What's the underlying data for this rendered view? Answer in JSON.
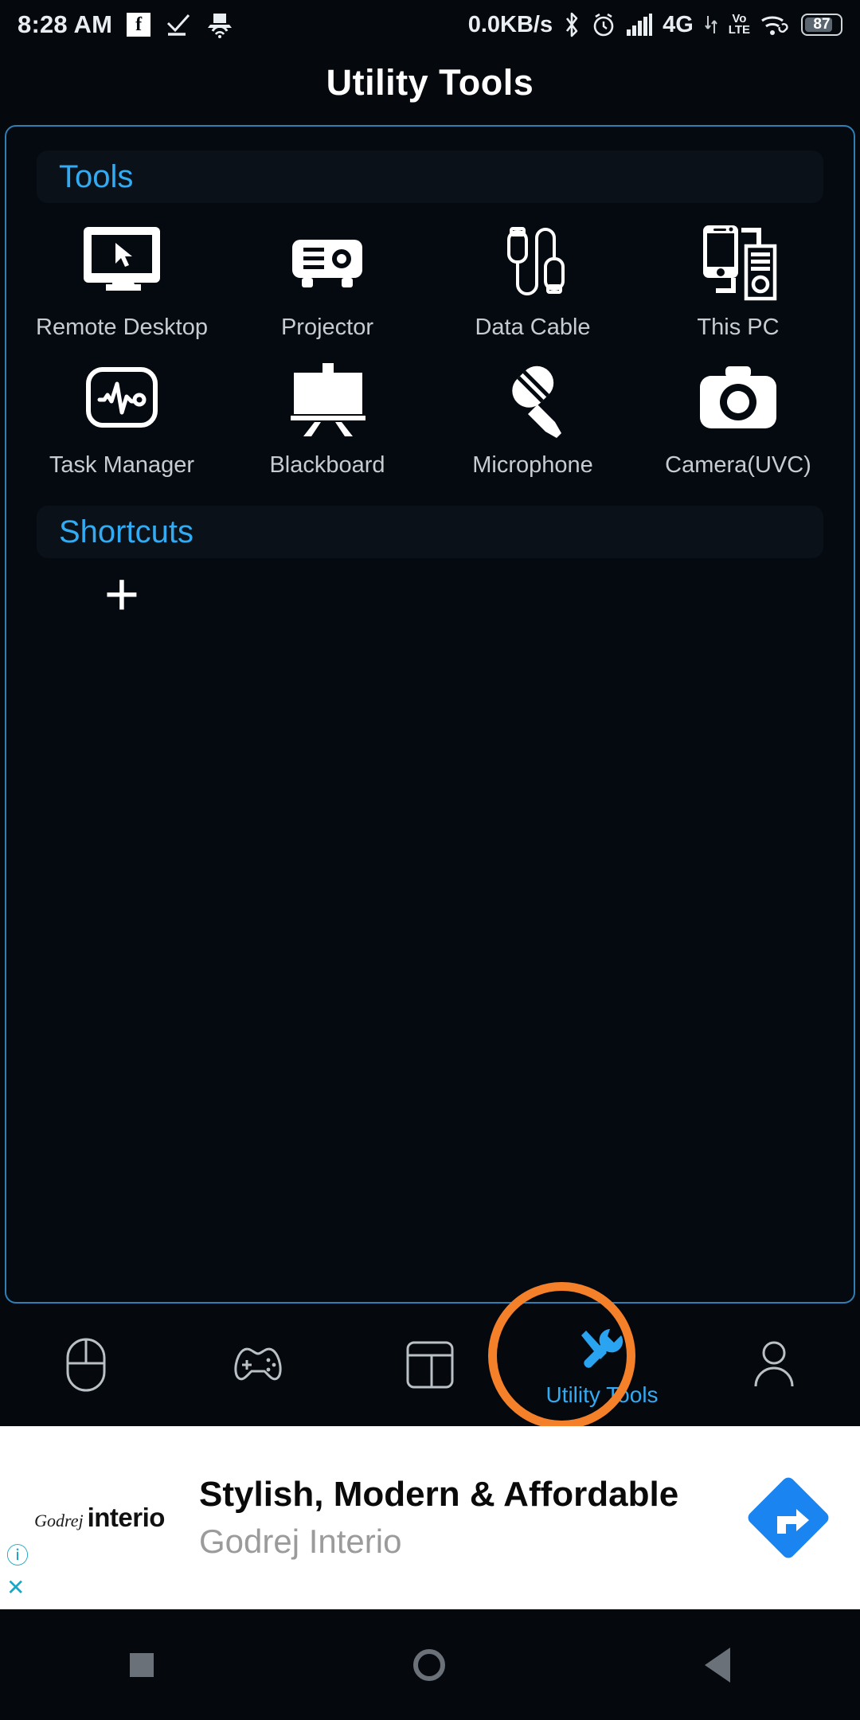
{
  "status_bar": {
    "time": "8:28 AM",
    "network_speed": "0.0KB/s",
    "network_type": "4G",
    "volte_top": "Vo",
    "volte_bottom": "LTE",
    "battery_level": "87",
    "icons": [
      "facebook-icon",
      "checkmark-icon",
      "laptop-wifi-icon",
      "bluetooth-icon",
      "alarm-clock-icon",
      "signal-bars-icon",
      "data-transfer-arrows-icon",
      "wifi-link-icon",
      "battery-icon"
    ]
  },
  "header": {
    "title": "Utility Tools"
  },
  "sections": {
    "tools": {
      "label": "Tools",
      "items": [
        {
          "label": "Remote Desktop",
          "icon": "monitor-cursor-icon"
        },
        {
          "label": "Projector",
          "icon": "projector-icon"
        },
        {
          "label": "Data Cable",
          "icon": "usb-cable-icon"
        },
        {
          "label": "This PC",
          "icon": "phone-pc-icon"
        },
        {
          "label": "Task Manager",
          "icon": "pulse-monitor-icon"
        },
        {
          "label": "Blackboard",
          "icon": "easel-board-icon"
        },
        {
          "label": "Microphone",
          "icon": "microphone-icon"
        },
        {
          "label": "Camera(UVC)",
          "icon": "camera-icon"
        }
      ]
    },
    "shortcuts": {
      "label": "Shortcuts",
      "add_label": "+",
      "items": []
    }
  },
  "bottom_nav": {
    "items": [
      {
        "label": "",
        "icon": "mouse-icon",
        "active": false
      },
      {
        "label": "",
        "icon": "gamepad-icon",
        "active": false
      },
      {
        "label": "",
        "icon": "layout-panel-icon",
        "active": false
      },
      {
        "label": "Utility Tools",
        "icon": "wrench-screwdriver-icon",
        "active": true
      },
      {
        "label": "",
        "icon": "person-icon",
        "active": false
      }
    ],
    "highlight_shape": "orange-circle-annotation"
  },
  "ad": {
    "brand_script": "Godrej",
    "brand_name": "interio",
    "headline": "Stylish, Modern & Affordable",
    "advertiser": "Godrej Interio",
    "info_icon": "ad-info-icon",
    "close_icon": "ad-close-icon",
    "cta_icon": "blue-arrow-diamond-icon"
  },
  "system_nav": {
    "recent": "square-recents-icon",
    "home": "circle-home-icon",
    "back": "triangle-back-icon"
  },
  "colors": {
    "accent_blue": "#32abf2",
    "panel_border": "#2f7fb5",
    "highlight_orange": "#f4802a",
    "background": "#05080d",
    "label_grey": "#c7ccd1"
  }
}
